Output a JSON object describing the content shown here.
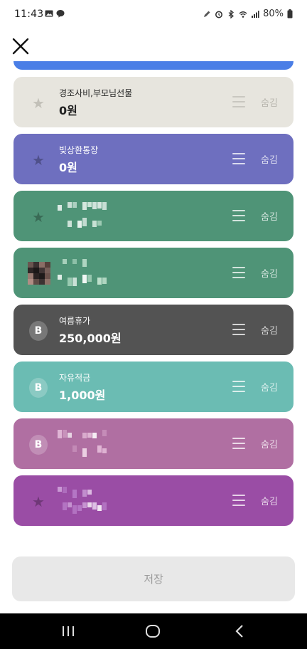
{
  "status_bar": {
    "time": "11:43",
    "notification_icons": [
      "image-icon",
      "chat-bubble-icon"
    ],
    "system_icons": [
      "pen-icon",
      "alarm-icon",
      "bluetooth-icon",
      "wifi-icon",
      "signal-icon"
    ],
    "battery": "80%"
  },
  "header": {
    "close_icon": "close-icon"
  },
  "accounts": [
    {
      "name": "경조사비,부모님선물",
      "amount": "0원",
      "lead": "star",
      "handle_icon": "drag-handle-icon",
      "hide_label": "숨김",
      "color": "#e7e5de"
    },
    {
      "name": "빚상환통장",
      "amount": "0원",
      "lead": "star",
      "handle_icon": "drag-handle-icon",
      "hide_label": "숨김",
      "color": "#6e6fbf"
    },
    {
      "name": "",
      "amount": "",
      "lead": "star",
      "handle_icon": "drag-handle-icon",
      "hide_label": "숨김",
      "color": "#4f9477",
      "redacted": true
    },
    {
      "name": "",
      "amount": "",
      "lead": "avatar",
      "handle_icon": "drag-handle-icon",
      "hide_label": "숨김",
      "color": "#4f9477",
      "redacted": true
    },
    {
      "name": "여름휴가",
      "amount": "250,000원",
      "lead": "B",
      "handle_icon": "drag-handle-icon",
      "hide_label": "숨김",
      "color": "#535353"
    },
    {
      "name": "자유적금",
      "amount": "1,000원",
      "lead": "B",
      "handle_icon": "drag-handle-icon",
      "hide_label": "숨김",
      "color": "#6bbcb3"
    },
    {
      "name": "",
      "amount": "",
      "lead": "B",
      "handle_icon": "drag-handle-icon",
      "hide_label": "숨김",
      "color": "#b06fa2",
      "redacted": true
    },
    {
      "name": "",
      "amount": "",
      "lead": "star",
      "handle_icon": "drag-handle-icon",
      "hide_label": "숨김",
      "color": "#9a4da5",
      "redacted": true
    }
  ],
  "save_button": {
    "label": "저장"
  },
  "nav_bar": {
    "icons": [
      "recent-apps-icon",
      "home-icon",
      "back-icon"
    ]
  }
}
